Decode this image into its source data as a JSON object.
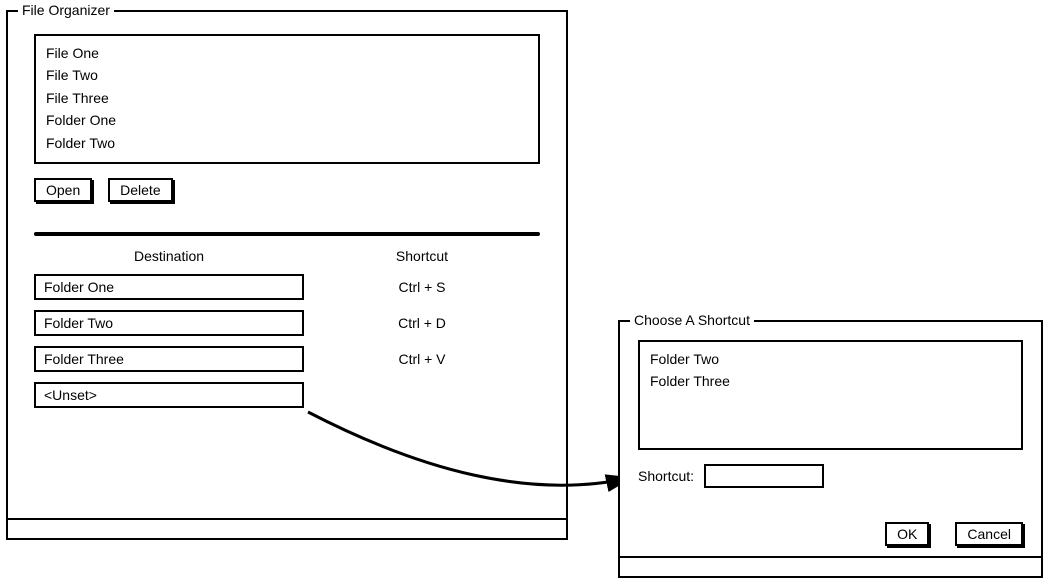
{
  "main": {
    "title": "File Organizer",
    "files": [
      "File One",
      "File Two",
      "File Three",
      "Folder One",
      "Folder Two"
    ],
    "open_label": "Open",
    "delete_label": "Delete",
    "columns": {
      "destination": "Destination",
      "shortcut": "Shortcut"
    },
    "mappings": [
      {
        "destination": "Folder One",
        "shortcut": "Ctrl + S"
      },
      {
        "destination": "Folder Two",
        "shortcut": "Ctrl + D"
      },
      {
        "destination": "Folder Three",
        "shortcut": "Ctrl + V"
      },
      {
        "destination": "<Unset>",
        "shortcut": ""
      }
    ]
  },
  "dialog": {
    "title": "Choose A Shortcut",
    "options": [
      "Folder Two",
      "Folder Three"
    ],
    "shortcut_label": "Shortcut:",
    "shortcut_value": "",
    "ok_label": "OK",
    "cancel_label": "Cancel"
  }
}
